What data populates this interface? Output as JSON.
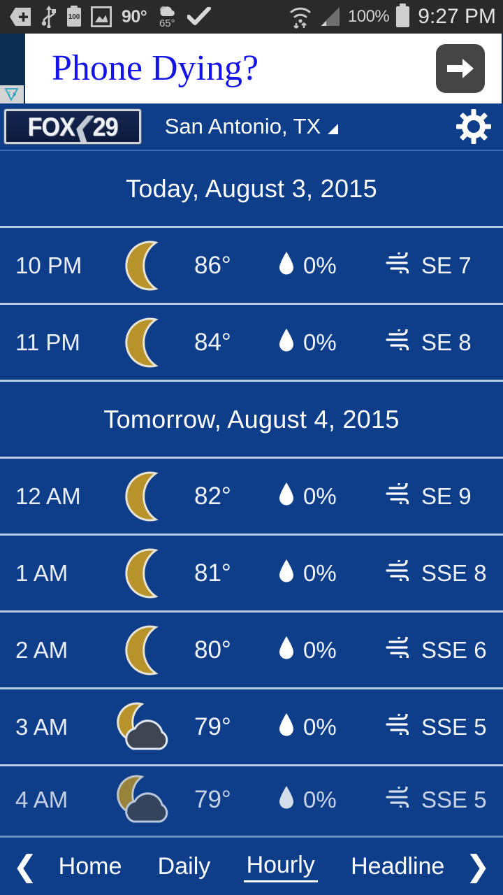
{
  "status_bar": {
    "icons": [
      "sd-card-icon",
      "usb-icon",
      "battery-100-icon",
      "screenshot-icon"
    ],
    "battery_badge": "100",
    "weather_temp": "90°",
    "weather_low": "65°",
    "weather_icon": "cloud-sun-icon",
    "check_icon": "checkmark-icon",
    "wifi_icon": "wifi-data-transfer-icon",
    "signal_icon": "cellular-signal-icon",
    "battery_percent": "100%",
    "battery_icon": "battery-full-icon",
    "clock": "9:27 PM"
  },
  "ad": {
    "headline": "Phone Dying?",
    "cta_icon": "arrow-right-icon",
    "adchoices_icon": "adchoices-icon",
    "adchoices_label": "i"
  },
  "header": {
    "logo_part1": "FOX",
    "logo_sep": "❮",
    "logo_part2": "29",
    "location": "San Antonio, TX",
    "location_caret_icon": "dropdown-triangle-icon",
    "settings_icon": "gear-icon"
  },
  "main": {
    "groups": [
      {
        "day_label": "Today, August 3, 2015",
        "hours": [
          {
            "time": "10 PM",
            "icon": "moon-icon",
            "temp": "86°",
            "precip": "0%",
            "wind": "SE 7",
            "cut": false
          },
          {
            "time": "11 PM",
            "icon": "moon-icon",
            "temp": "84°",
            "precip": "0%",
            "wind": "SE 8",
            "cut": false
          }
        ]
      },
      {
        "day_label": "Tomorrow, August 4, 2015",
        "hours": [
          {
            "time": "12 AM",
            "icon": "moon-icon",
            "temp": "82°",
            "precip": "0%",
            "wind": "SE 9",
            "cut": false
          },
          {
            "time": "1 AM",
            "icon": "moon-icon",
            "temp": "81°",
            "precip": "0%",
            "wind": "SSE 8",
            "cut": false
          },
          {
            "time": "2 AM",
            "icon": "moon-icon",
            "temp": "80°",
            "precip": "0%",
            "wind": "SSE 6",
            "cut": false
          },
          {
            "time": "3 AM",
            "icon": "moon-cloud-icon",
            "temp": "79°",
            "precip": "0%",
            "wind": "SSE 5",
            "cut": false
          },
          {
            "time": "4 AM",
            "icon": "moon-cloud-icon",
            "temp": "79°",
            "precip": "0%",
            "wind": "SSE 5",
            "cut": true
          }
        ]
      }
    ],
    "precip_icon": "water-droplet-icon",
    "wind_icon": "wind-icon"
  },
  "bottom_nav": {
    "prev_icon": "chevron-left-icon",
    "next_icon": "chevron-right-icon",
    "prev_glyph": "❮",
    "next_glyph": "❯",
    "tabs": [
      {
        "label": "Home",
        "active": false
      },
      {
        "label": "Daily",
        "active": false
      },
      {
        "label": "Hourly",
        "active": true
      },
      {
        "label": "Headline",
        "active": false
      }
    ]
  },
  "colors": {
    "app_blue": "#0e3d8a",
    "separator": "#b9cce3",
    "status_bar": "#2a2a2a",
    "ad_text_blue": "#1414e6",
    "moon_gold": "#b8932a",
    "cloud_gray": "#3d4652"
  }
}
